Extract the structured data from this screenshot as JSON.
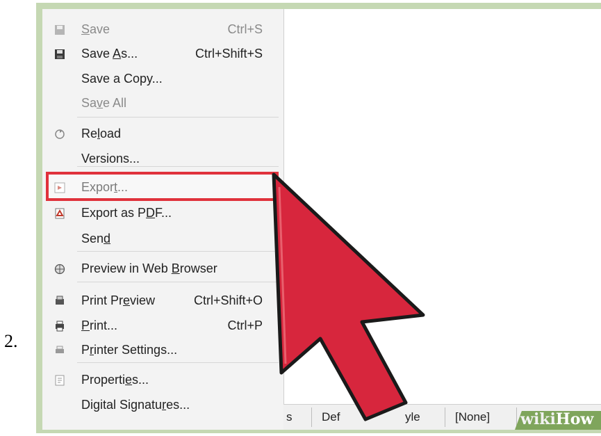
{
  "step_number": "2.",
  "menu": {
    "items": [
      {
        "label": "Save",
        "mnemonic_index": 0,
        "shortcut": "Ctrl+S",
        "icon": "save-icon",
        "disabled": true
      },
      {
        "label": "Save As...",
        "mnemonic_index": 5,
        "shortcut": "Ctrl+Shift+S",
        "icon": "save-as-icon",
        "disabled": false
      },
      {
        "label": "Save a Copy...",
        "mnemonic_index": -1,
        "shortcut": "",
        "icon": "",
        "disabled": false
      },
      {
        "label": "Save All",
        "mnemonic_index": 2,
        "shortcut": "",
        "icon": "",
        "disabled": true
      },
      {
        "label": "Reload",
        "mnemonic_index": 2,
        "shortcut": "",
        "icon": "reload-icon",
        "disabled": false
      },
      {
        "label": "Versions...",
        "mnemonic_index": -1,
        "shortcut": "",
        "icon": "",
        "disabled": false
      },
      {
        "label": "Export...",
        "mnemonic_index": 5,
        "shortcut": "",
        "icon": "export-icon",
        "disabled": false,
        "highlighted": true
      },
      {
        "label": "Export as PDF...",
        "mnemonic_index": 11,
        "shortcut": "",
        "icon": "pdf-icon",
        "disabled": false
      },
      {
        "label": "Send",
        "mnemonic_index": 3,
        "shortcut": "",
        "icon": "",
        "disabled": false
      },
      {
        "label": "Preview in Web Browser",
        "mnemonic_index": 15,
        "shortcut": "",
        "icon": "globe-icon",
        "disabled": false
      },
      {
        "label": "Print Preview",
        "mnemonic_index": 8,
        "shortcut": "Ctrl+Shift+O",
        "icon": "print-preview-icon",
        "disabled": false
      },
      {
        "label": "Print...",
        "mnemonic_index": 0,
        "shortcut": "Ctrl+P",
        "icon": "printer-icon",
        "disabled": false
      },
      {
        "label": "Printer Settings...",
        "mnemonic_index": 1,
        "shortcut": "",
        "icon": "printer-settings-icon",
        "disabled": false
      },
      {
        "label": "Properties...",
        "mnemonic_index": 8,
        "shortcut": "",
        "icon": "properties-icon",
        "disabled": false
      },
      {
        "label": "Digital Signatures...",
        "mnemonic_index": 15,
        "shortcut": "",
        "icon": "",
        "disabled": false
      }
    ]
  },
  "statusbar": {
    "cell1": "s",
    "cell2": "Def",
    "cell2b": "yle",
    "cell3": "[None]"
  },
  "watermark": {
    "wiki": "wiki",
    "how": "How"
  },
  "colors": {
    "frame": "#c5d8b3",
    "highlight": "#e0323c",
    "arrow": "#d7263d",
    "watermark_band": "#7fa55c"
  }
}
